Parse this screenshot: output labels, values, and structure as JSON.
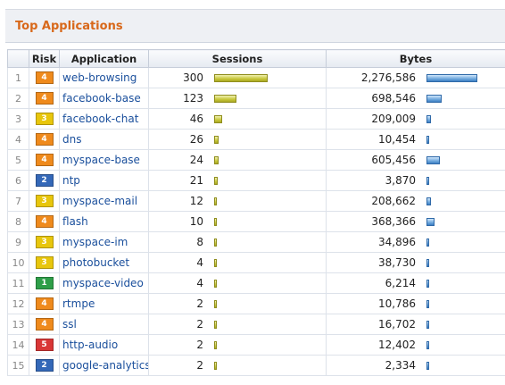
{
  "panel": {
    "title": "Top Applications"
  },
  "columns": {
    "risk": "Risk",
    "application": "Application",
    "sessions": "Sessions",
    "bytes": "Bytes"
  },
  "risk_colors": {
    "1": "#2e9e48",
    "2": "#3468b8",
    "3": "#e8c60c",
    "4": "#ef8a1c",
    "5": "#d93636"
  },
  "bar_scale": {
    "sessions_max": 300,
    "bytes_max": 2276586
  },
  "rows": [
    {
      "index": "1",
      "risk": "4",
      "application": "web-browsing",
      "sessions": "300",
      "bytes": "2,276,586"
    },
    {
      "index": "2",
      "risk": "4",
      "application": "facebook-base",
      "sessions": "123",
      "bytes": "698,546"
    },
    {
      "index": "3",
      "risk": "3",
      "application": "facebook-chat",
      "sessions": "46",
      "bytes": "209,009"
    },
    {
      "index": "4",
      "risk": "4",
      "application": "dns",
      "sessions": "26",
      "bytes": "10,454"
    },
    {
      "index": "5",
      "risk": "4",
      "application": "myspace-base",
      "sessions": "24",
      "bytes": "605,456"
    },
    {
      "index": "6",
      "risk": "2",
      "application": "ntp",
      "sessions": "21",
      "bytes": "3,870"
    },
    {
      "index": "7",
      "risk": "3",
      "application": "myspace-mail",
      "sessions": "12",
      "bytes": "208,662"
    },
    {
      "index": "8",
      "risk": "4",
      "application": "flash",
      "sessions": "10",
      "bytes": "368,366"
    },
    {
      "index": "9",
      "risk": "3",
      "application": "myspace-im",
      "sessions": "8",
      "bytes": "34,896"
    },
    {
      "index": "10",
      "risk": "3",
      "application": "photobucket",
      "sessions": "4",
      "bytes": "38,730"
    },
    {
      "index": "11",
      "risk": "1",
      "application": "myspace-video",
      "sessions": "4",
      "bytes": "6,214"
    },
    {
      "index": "12",
      "risk": "4",
      "application": "rtmpe",
      "sessions": "2",
      "bytes": "10,786"
    },
    {
      "index": "13",
      "risk": "4",
      "application": "ssl",
      "sessions": "2",
      "bytes": "16,702"
    },
    {
      "index": "14",
      "risk": "5",
      "application": "http-audio",
      "sessions": "2",
      "bytes": "12,402"
    },
    {
      "index": "15",
      "risk": "2",
      "application": "google-analytics",
      "sessions": "2",
      "bytes": "2,334"
    }
  ]
}
